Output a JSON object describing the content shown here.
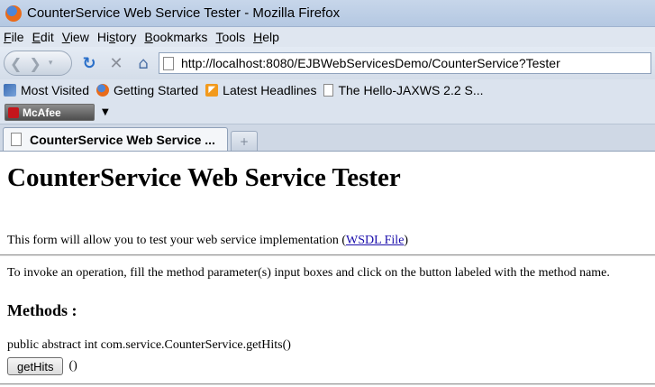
{
  "window": {
    "title": "CounterService Web Service Tester - Mozilla Firefox"
  },
  "menu": {
    "items": [
      {
        "underline": "F",
        "rest": "ile"
      },
      {
        "underline": "E",
        "rest": "dit"
      },
      {
        "underline": "V",
        "rest": "iew"
      },
      {
        "prefix": "Hi",
        "underline": "s",
        "rest": "tory"
      },
      {
        "underline": "B",
        "rest": "ookmarks"
      },
      {
        "underline": "T",
        "rest": "ools"
      },
      {
        "underline": "H",
        "rest": "elp"
      }
    ]
  },
  "navigation": {
    "url": "http://localhost:8080/EJBWebServicesDemo/CounterService?Tester",
    "back_icon": "back-arrow-icon",
    "forward_icon": "forward-arrow-icon",
    "reload_icon": "reload-icon",
    "stop_icon": "stop-icon",
    "home_icon": "home-icon"
  },
  "bookmarks": {
    "items": [
      {
        "label": "Most Visited",
        "icon": "most-visited-icon"
      },
      {
        "label": "Getting Started",
        "icon": "firefox-icon"
      },
      {
        "label": "Latest Headlines",
        "icon": "rss-icon"
      },
      {
        "label": "The Hello-JAXWS 2.2 S...",
        "icon": "page-icon"
      }
    ]
  },
  "toolbar": {
    "mcafee_label": "McAfee"
  },
  "tabs": [
    {
      "label": "CounterService Web Service ...",
      "active": true
    }
  ],
  "page": {
    "title": "CounterService Web Service Tester",
    "intro_text": "This form will allow you to test your web service implementation (",
    "wsdl_link": "WSDL File",
    "intro_close": ")",
    "instructions": "To invoke an operation, fill the method parameter(s) input boxes and click on the button labeled with the method name.",
    "methods_heading": "Methods :",
    "methods": [
      {
        "signature": "public abstract int com.service.CounterService.getHits()",
        "button_label": "getHits",
        "params": "()"
      }
    ]
  },
  "colors": {
    "link": "#1a0dab",
    "titlebar": "#c7d6ea",
    "chrome": "#dbe3ee"
  }
}
